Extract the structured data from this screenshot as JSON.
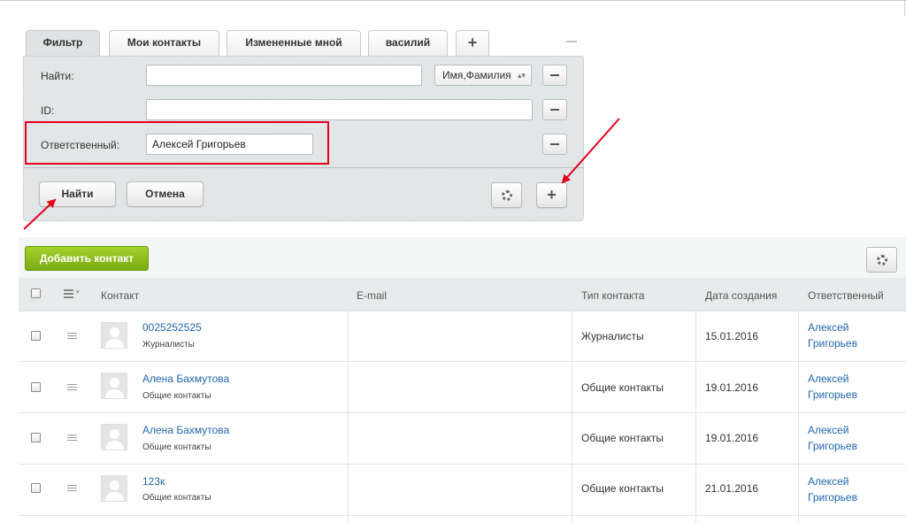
{
  "filter": {
    "tabs": [
      {
        "label": "Фильтр"
      },
      {
        "label": "Мои контакты"
      },
      {
        "label": "Измененные мной"
      },
      {
        "label": "василий"
      },
      {
        "label": "+"
      }
    ],
    "fields": {
      "find": {
        "label": "Найти:",
        "value": "",
        "select_value": "Имя,Фамилия"
      },
      "id": {
        "label": "ID:",
        "value": ""
      },
      "responsible": {
        "label": "Ответственный:",
        "value": "Алексей Григорьев"
      }
    },
    "buttons": {
      "find": "Найти",
      "cancel": "Отмена"
    }
  },
  "toolbar": {
    "add_contact": "Добавить контакт"
  },
  "grid": {
    "columns": {
      "contact": "Контакт",
      "email": "E-mail",
      "type": "Тип контакта",
      "created": "Дата создания",
      "responsible": "Ответственный"
    },
    "rows": [
      {
        "name": "0025252525",
        "group": "Журналисты",
        "email": "",
        "type": "Журналисты",
        "created": "15.01.2016",
        "resp_first": "Алексей",
        "resp_last": "Григорьев"
      },
      {
        "name": "Алена Бахмутова",
        "group": "Общие контакты",
        "email": "",
        "type": "Общие контакты",
        "created": "19.01.2016",
        "resp_first": "Алексей",
        "resp_last": "Григорьев"
      },
      {
        "name": "Алена Бахмутова",
        "group": "Общие контакты",
        "email": "",
        "type": "Общие контакты",
        "created": "19.01.2016",
        "resp_first": "Алексей",
        "resp_last": "Григорьев"
      },
      {
        "name": "123к",
        "group": "Общие контакты",
        "email": "",
        "type": "Общие контакты",
        "created": "21.01.2016",
        "resp_first": "Алексей",
        "resp_last": "Григорьев"
      }
    ]
  },
  "colors": {
    "accent_green": "#8dbd1d",
    "link_blue": "#2067b0",
    "annotation_red": "#e3001b"
  }
}
